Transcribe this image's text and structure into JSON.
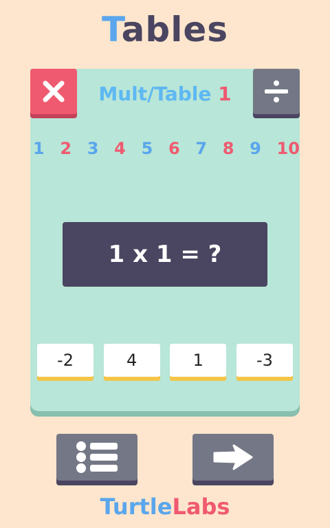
{
  "app": {
    "title_first": "T",
    "title_rest": "ables"
  },
  "card": {
    "title_label": "Mult/Table",
    "title_number": "1"
  },
  "numbers": [
    "1",
    "2",
    "3",
    "4",
    "5",
    "6",
    "7",
    "8",
    "9",
    "10"
  ],
  "question": "1 x 1 = ?",
  "answers": [
    "-2",
    "4",
    "1",
    "-3"
  ],
  "footer": {
    "part1": "Turtle",
    "part2": "Labs"
  },
  "colors": {
    "background": "#fde6cd",
    "card": "#b8e6d8",
    "blue": "#5aa6ec",
    "red": "#ef5a70",
    "dark": "#4a4560",
    "gray": "#747785",
    "yellow": "#f4c548"
  },
  "icons": {
    "close": "close-icon",
    "divide": "divide-icon",
    "list": "list-icon",
    "next": "arrow-right-icon"
  }
}
